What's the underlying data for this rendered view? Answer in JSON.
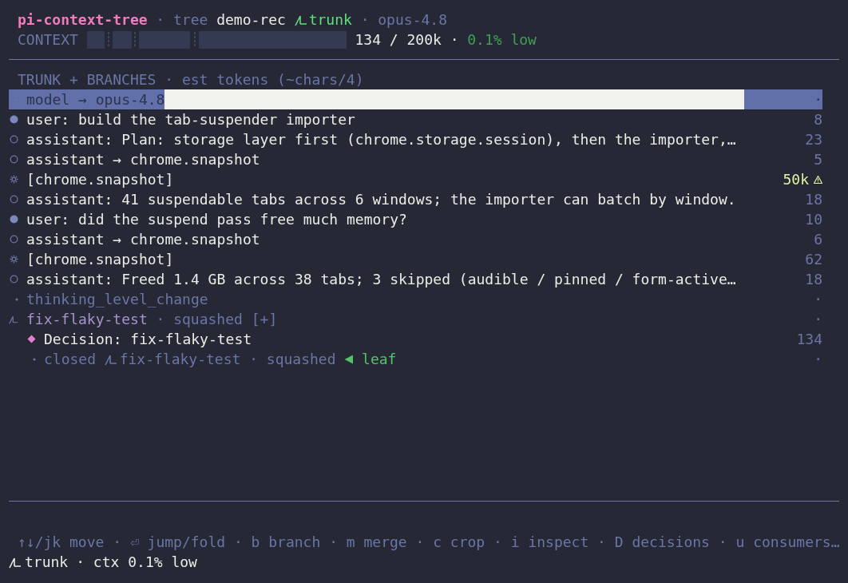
{
  "header": {
    "parts": [
      {
        "kind": "title",
        "text": "pi-context-tree"
      },
      {
        "kind": "sep",
        "text": "·"
      },
      {
        "kind": "mode",
        "text": "tree"
      },
      {
        "kind": "session",
        "text": "demo-rec"
      },
      {
        "kind": "branch",
        "text": "trunk"
      },
      {
        "kind": "sep",
        "text": "·"
      },
      {
        "kind": "model",
        "text": "opus-4.8"
      }
    ]
  },
  "context": {
    "label": "CONTEXT",
    "usage": "134 / 200k",
    "sep": "·",
    "status": "0.1% low"
  },
  "tree": {
    "heading": "TRUNK + BRANCHES · est tokens (~chars/4)",
    "rows": [
      {
        "kind": "event",
        "text": "model → opus-4.8",
        "tokens": "·",
        "selected": true,
        "warning": false
      },
      {
        "kind": "user",
        "text": "user: build the tab-suspender importer",
        "tokens": "8",
        "selected": false,
        "warning": false
      },
      {
        "kind": "assistant",
        "text": "assistant: Plan: storage layer first (chrome.storage.session), then the importer,…",
        "tokens": "23",
        "selected": false,
        "warning": false
      },
      {
        "kind": "assistant",
        "text": "assistant → chrome.snapshot",
        "tokens": "5",
        "selected": false,
        "warning": false
      },
      {
        "kind": "tool",
        "text": "[chrome.snapshot]",
        "tokens": "50k",
        "selected": false,
        "warning": true
      },
      {
        "kind": "assistant",
        "text": "assistant: 41 suspendable tabs across 6 windows; the importer can batch by window.",
        "tokens": "18",
        "selected": false,
        "warning": false
      },
      {
        "kind": "user",
        "text": "user: did the suspend pass free much memory?",
        "tokens": "10",
        "selected": false,
        "warning": false
      },
      {
        "kind": "assistant",
        "text": "assistant → chrome.snapshot",
        "tokens": "6",
        "selected": false,
        "warning": false
      },
      {
        "kind": "tool",
        "text": "[chrome.snapshot]",
        "tokens": "62",
        "selected": false,
        "warning": false
      },
      {
        "kind": "assistant",
        "text": "assistant: Freed 1.4 GB across 38 tabs; 3 skipped (audible / pinned / form-active…",
        "tokens": "18",
        "selected": false,
        "warning": false
      },
      {
        "kind": "event",
        "text": "thinking_level_change",
        "tokens": "·",
        "selected": false,
        "warning": false
      },
      {
        "kind": "branch",
        "name": "fix-flaky-test",
        "note": "· squashed [+]",
        "tokens": "·",
        "selected": false,
        "warning": false,
        "children": [
          {
            "kind": "decision",
            "text": "Decision: fix-flaky-test",
            "tokens": "134",
            "selected": false,
            "warning": false
          },
          {
            "kind": "closed",
            "text": "closed",
            "name": "fix-flaky-test",
            "note": "· squashed",
            "leaf": "leaf",
            "tokens": "·",
            "selected": false,
            "warning": false
          }
        ]
      }
    ]
  },
  "footer": {
    "hints": "↑↓/jk move · ⏎ jump/fold · b branch · m merge · c crop · i inspect · D decisions · u consumers…",
    "status": {
      "branch": "trunk",
      "text": "· ctx 0.1% low"
    }
  }
}
